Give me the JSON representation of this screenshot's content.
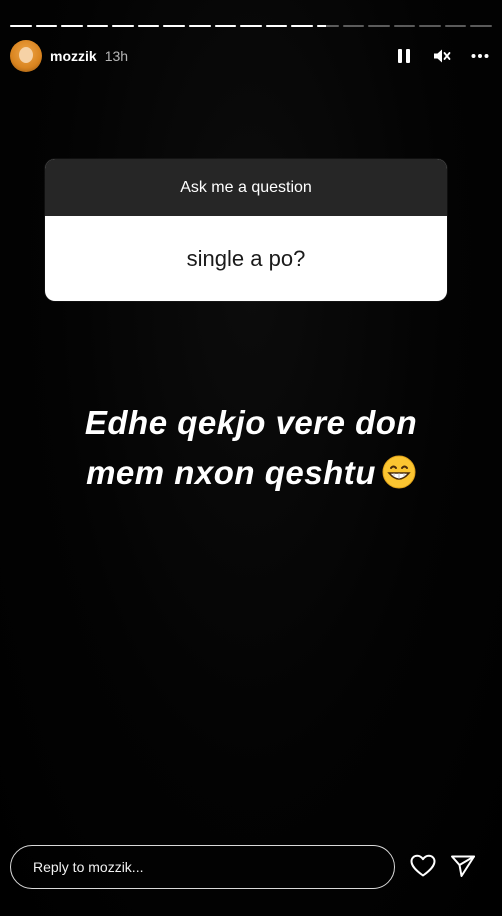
{
  "story": {
    "progress": {
      "segment_count": 19,
      "completed_segments": 12,
      "current_segment_fill": 0.4
    },
    "header": {
      "username": "mozzik",
      "time_ago": "13h",
      "icons": [
        "pause-icon",
        "mute-icon",
        "more-icon"
      ]
    },
    "question_sticker": {
      "header": "Ask me a question",
      "answer": "single a po?"
    },
    "caption": {
      "line1": "Edhe qekjo vere don",
      "line2": "mem nxon qeshtu",
      "emoji": "😁"
    },
    "reply": {
      "placeholder": "Reply to mozzik..."
    },
    "actions": [
      "heart-icon",
      "send-icon"
    ],
    "colors": {
      "background": "#000000",
      "sticker_header": "#262626",
      "sticker_body": "#ffffff"
    }
  }
}
